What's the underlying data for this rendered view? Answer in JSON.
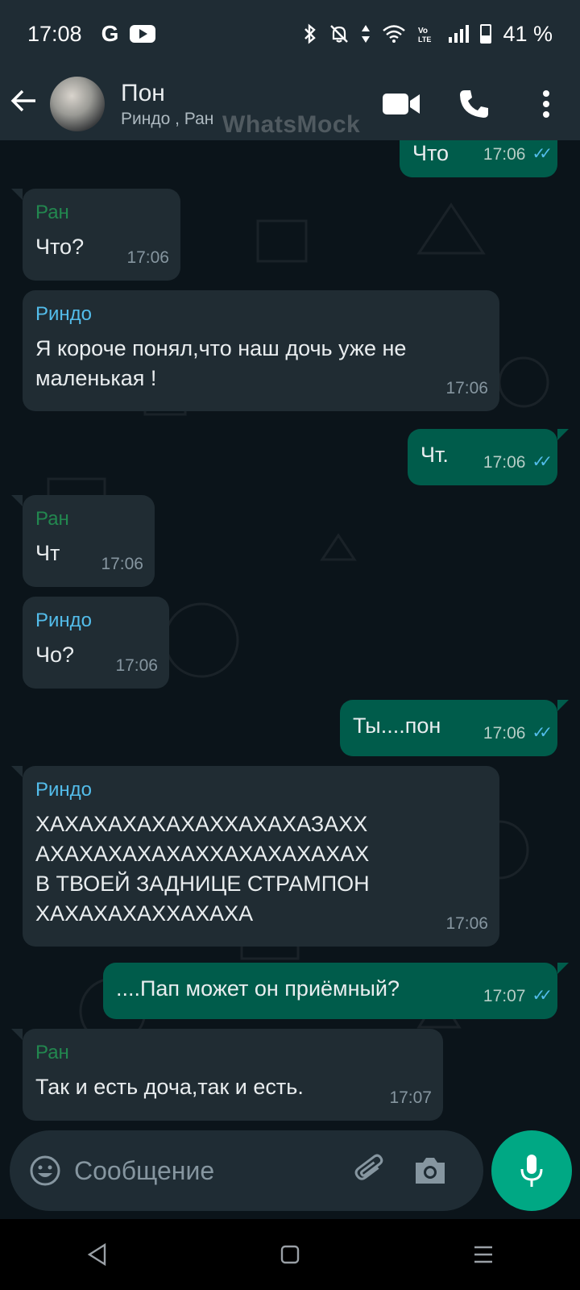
{
  "status_bar": {
    "time": "17:08",
    "google_label": "G",
    "battery_percent": "41 %",
    "battery_level": 0.41
  },
  "header": {
    "title": "Пон",
    "subtitle": "Риндо , Ран",
    "watermark": "WhatsMock"
  },
  "messages": [
    {
      "direction": "out",
      "text": "Что",
      "time": "17:06"
    },
    {
      "direction": "in",
      "sender": "Ран",
      "text": "Что?",
      "time": "17:06"
    },
    {
      "direction": "in",
      "sender": "Риндо",
      "text_lines": [
        "Я короче понял,что наш дочь уже не",
        "маленькая !"
      ],
      "time": "17:06"
    },
    {
      "direction": "out",
      "text": "Чт.",
      "time": "17:06"
    },
    {
      "direction": "in",
      "sender": "Ран",
      "text": "Чт",
      "time": "17:06"
    },
    {
      "direction": "in",
      "sender": "Риндо",
      "text": "Чо?",
      "time": "17:06"
    },
    {
      "direction": "out",
      "text": "Ты....пон",
      "time": "17:06"
    },
    {
      "direction": "in",
      "sender": "Риндо",
      "text_lines": [
        "ХАХАХАХАХАХАХХАХАХАЗАХХ",
        "АХАХАХАХАХАХХАХАХАХАХАХ",
        "В ТВОЕЙ ЗАДНИЦЕ СТРАМПОН",
        "ХАХАХАХАХХАХАХА"
      ],
      "time": "17:06"
    },
    {
      "direction": "out",
      "text": "....Пап может он приёмный?",
      "time": "17:07"
    },
    {
      "direction": "in",
      "sender": "Ран",
      "text": "Так и есть доча,так и есть.",
      "time": "17:07"
    }
  ],
  "composer": {
    "placeholder": "Сообщение"
  },
  "colors": {
    "chat_bg": "#0b141a",
    "bar_bg": "#1f2c34",
    "incoming_bubble": "#202c33",
    "outgoing_bubble": "#005c4b",
    "accent": "#00a884",
    "read_ticks": "#53bdeb"
  },
  "icons": {
    "header": [
      "back-arrow-icon",
      "video-call-icon",
      "phone-icon",
      "more-options-icon"
    ],
    "composer": [
      "emoji-icon",
      "attach-icon",
      "camera-icon",
      "mic-icon"
    ],
    "navbar": [
      "nav-back-icon",
      "nav-home-icon",
      "nav-menu-icon"
    ]
  }
}
